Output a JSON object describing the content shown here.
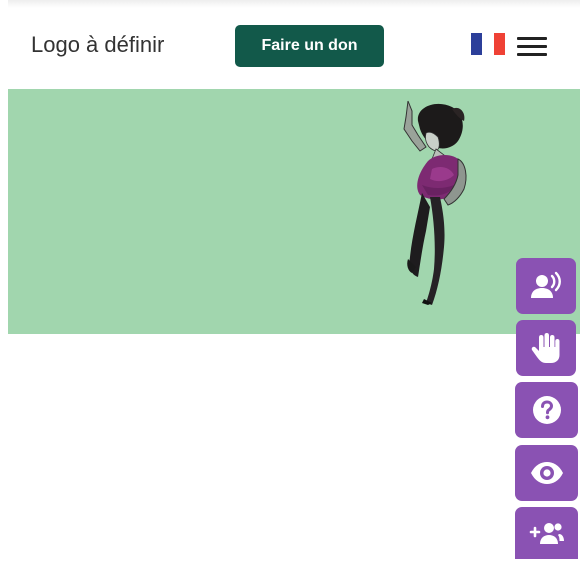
{
  "header": {
    "logo_text": "Logo à définir",
    "donate_label": "Faire un don",
    "language_flag": "france-flag-icon",
    "menu_icon": "hamburger-menu-icon"
  },
  "hero": {
    "illustration": "dancing-woman-illustration"
  },
  "accessibility_toolbar": [
    {
      "name": "text-to-speech",
      "icon": "speaking-person-icon"
    },
    {
      "name": "sign-language",
      "icon": "hand-icon"
    },
    {
      "name": "help",
      "icon": "question-mark-icon"
    },
    {
      "name": "visual-contrast",
      "icon": "eye-icon"
    },
    {
      "name": "accompaniment",
      "icon": "user-plus-icon"
    }
  ],
  "colors": {
    "hero_background": "#a1d6ae",
    "donate_button": "#12594a",
    "toolbar_purple": "#8a52b3",
    "flag_blue": "#2c3f9a",
    "flag_white": "#ffffff",
    "flag_red": "#ef4135"
  }
}
